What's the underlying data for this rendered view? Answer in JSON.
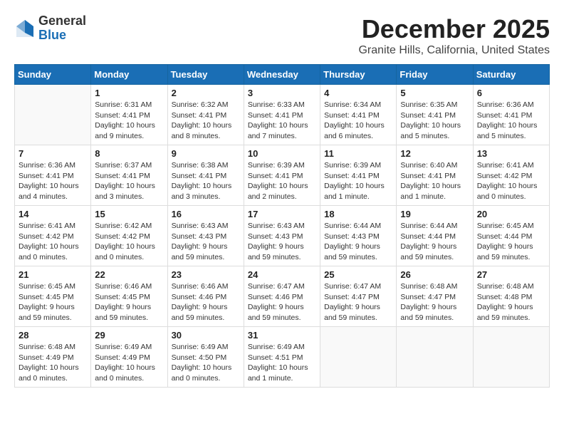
{
  "header": {
    "logo_general": "General",
    "logo_blue": "Blue",
    "main_title": "December 2025",
    "subtitle": "Granite Hills, California, United States"
  },
  "calendar": {
    "days_of_week": [
      "Sunday",
      "Monday",
      "Tuesday",
      "Wednesday",
      "Thursday",
      "Friday",
      "Saturday"
    ],
    "weeks": [
      [
        {
          "day": "",
          "info": ""
        },
        {
          "day": "1",
          "info": "Sunrise: 6:31 AM\nSunset: 4:41 PM\nDaylight: 10 hours\nand 9 minutes."
        },
        {
          "day": "2",
          "info": "Sunrise: 6:32 AM\nSunset: 4:41 PM\nDaylight: 10 hours\nand 8 minutes."
        },
        {
          "day": "3",
          "info": "Sunrise: 6:33 AM\nSunset: 4:41 PM\nDaylight: 10 hours\nand 7 minutes."
        },
        {
          "day": "4",
          "info": "Sunrise: 6:34 AM\nSunset: 4:41 PM\nDaylight: 10 hours\nand 6 minutes."
        },
        {
          "day": "5",
          "info": "Sunrise: 6:35 AM\nSunset: 4:41 PM\nDaylight: 10 hours\nand 5 minutes."
        },
        {
          "day": "6",
          "info": "Sunrise: 6:36 AM\nSunset: 4:41 PM\nDaylight: 10 hours\nand 5 minutes."
        }
      ],
      [
        {
          "day": "7",
          "info": "Sunrise: 6:36 AM\nSunset: 4:41 PM\nDaylight: 10 hours\nand 4 minutes."
        },
        {
          "day": "8",
          "info": "Sunrise: 6:37 AM\nSunset: 4:41 PM\nDaylight: 10 hours\nand 3 minutes."
        },
        {
          "day": "9",
          "info": "Sunrise: 6:38 AM\nSunset: 4:41 PM\nDaylight: 10 hours\nand 3 minutes."
        },
        {
          "day": "10",
          "info": "Sunrise: 6:39 AM\nSunset: 4:41 PM\nDaylight: 10 hours\nand 2 minutes."
        },
        {
          "day": "11",
          "info": "Sunrise: 6:39 AM\nSunset: 4:41 PM\nDaylight: 10 hours\nand 1 minute."
        },
        {
          "day": "12",
          "info": "Sunrise: 6:40 AM\nSunset: 4:41 PM\nDaylight: 10 hours\nand 1 minute."
        },
        {
          "day": "13",
          "info": "Sunrise: 6:41 AM\nSunset: 4:42 PM\nDaylight: 10 hours\nand 0 minutes."
        }
      ],
      [
        {
          "day": "14",
          "info": "Sunrise: 6:41 AM\nSunset: 4:42 PM\nDaylight: 10 hours\nand 0 minutes."
        },
        {
          "day": "15",
          "info": "Sunrise: 6:42 AM\nSunset: 4:42 PM\nDaylight: 10 hours\nand 0 minutes."
        },
        {
          "day": "16",
          "info": "Sunrise: 6:43 AM\nSunset: 4:43 PM\nDaylight: 9 hours\nand 59 minutes."
        },
        {
          "day": "17",
          "info": "Sunrise: 6:43 AM\nSunset: 4:43 PM\nDaylight: 9 hours\nand 59 minutes."
        },
        {
          "day": "18",
          "info": "Sunrise: 6:44 AM\nSunset: 4:43 PM\nDaylight: 9 hours\nand 59 minutes."
        },
        {
          "day": "19",
          "info": "Sunrise: 6:44 AM\nSunset: 4:44 PM\nDaylight: 9 hours\nand 59 minutes."
        },
        {
          "day": "20",
          "info": "Sunrise: 6:45 AM\nSunset: 4:44 PM\nDaylight: 9 hours\nand 59 minutes."
        }
      ],
      [
        {
          "day": "21",
          "info": "Sunrise: 6:45 AM\nSunset: 4:45 PM\nDaylight: 9 hours\nand 59 minutes."
        },
        {
          "day": "22",
          "info": "Sunrise: 6:46 AM\nSunset: 4:45 PM\nDaylight: 9 hours\nand 59 minutes."
        },
        {
          "day": "23",
          "info": "Sunrise: 6:46 AM\nSunset: 4:46 PM\nDaylight: 9 hours\nand 59 minutes."
        },
        {
          "day": "24",
          "info": "Sunrise: 6:47 AM\nSunset: 4:46 PM\nDaylight: 9 hours\nand 59 minutes."
        },
        {
          "day": "25",
          "info": "Sunrise: 6:47 AM\nSunset: 4:47 PM\nDaylight: 9 hours\nand 59 minutes."
        },
        {
          "day": "26",
          "info": "Sunrise: 6:48 AM\nSunset: 4:47 PM\nDaylight: 9 hours\nand 59 minutes."
        },
        {
          "day": "27",
          "info": "Sunrise: 6:48 AM\nSunset: 4:48 PM\nDaylight: 9 hours\nand 59 minutes."
        }
      ],
      [
        {
          "day": "28",
          "info": "Sunrise: 6:48 AM\nSunset: 4:49 PM\nDaylight: 10 hours\nand 0 minutes."
        },
        {
          "day": "29",
          "info": "Sunrise: 6:49 AM\nSunset: 4:49 PM\nDaylight: 10 hours\nand 0 minutes."
        },
        {
          "day": "30",
          "info": "Sunrise: 6:49 AM\nSunset: 4:50 PM\nDaylight: 10 hours\nand 0 minutes."
        },
        {
          "day": "31",
          "info": "Sunrise: 6:49 AM\nSunset: 4:51 PM\nDaylight: 10 hours\nand 1 minute."
        },
        {
          "day": "",
          "info": ""
        },
        {
          "day": "",
          "info": ""
        },
        {
          "day": "",
          "info": ""
        }
      ]
    ]
  }
}
